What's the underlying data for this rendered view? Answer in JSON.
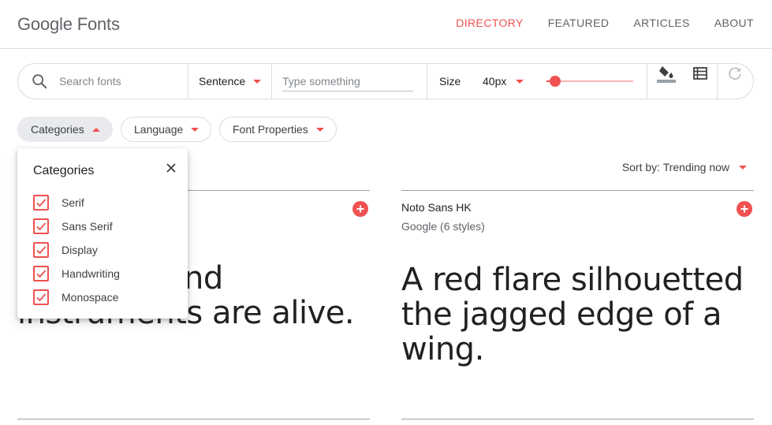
{
  "header": {
    "logo_brand": "Google",
    "logo_product": "Fonts",
    "nav": [
      {
        "label": "DIRECTORY",
        "active": true
      },
      {
        "label": "FEATURED",
        "active": false
      },
      {
        "label": "ARTICLES",
        "active": false
      },
      {
        "label": "ABOUT",
        "active": false
      }
    ]
  },
  "toolbar": {
    "search_icon": "search-icon",
    "search_placeholder": "Search fonts",
    "mode_value": "Sentence",
    "type_placeholder": "Type something",
    "size_label": "Size",
    "size_value": "40px",
    "slider_fraction": 0.1,
    "icons": [
      "background-color-icon",
      "list-view-icon",
      "refresh-icon"
    ]
  },
  "filters": {
    "categories": "Categories",
    "language": "Language",
    "font_properties": "Font Properties"
  },
  "sort": {
    "label": "Sort by: Trending now"
  },
  "categories_popup": {
    "title": "Categories",
    "options": [
      {
        "label": "Serif",
        "checked": true
      },
      {
        "label": "Sans Serif",
        "checked": true
      },
      {
        "label": "Display",
        "checked": true
      },
      {
        "label": "Handwriting",
        "checked": true
      },
      {
        "label": "Monospace",
        "checked": true
      }
    ]
  },
  "cards": [
    {
      "sample": "...ipment and instruments are alive."
    },
    {
      "name": "Noto Sans HK",
      "meta": "Google (6 styles)",
      "sample": "A red flare silhouetted the jagged edge of a wing."
    }
  ],
  "colors": {
    "accent": "#f05151",
    "text": "#202124",
    "muted": "#5f6368",
    "border": "#dadce0"
  }
}
